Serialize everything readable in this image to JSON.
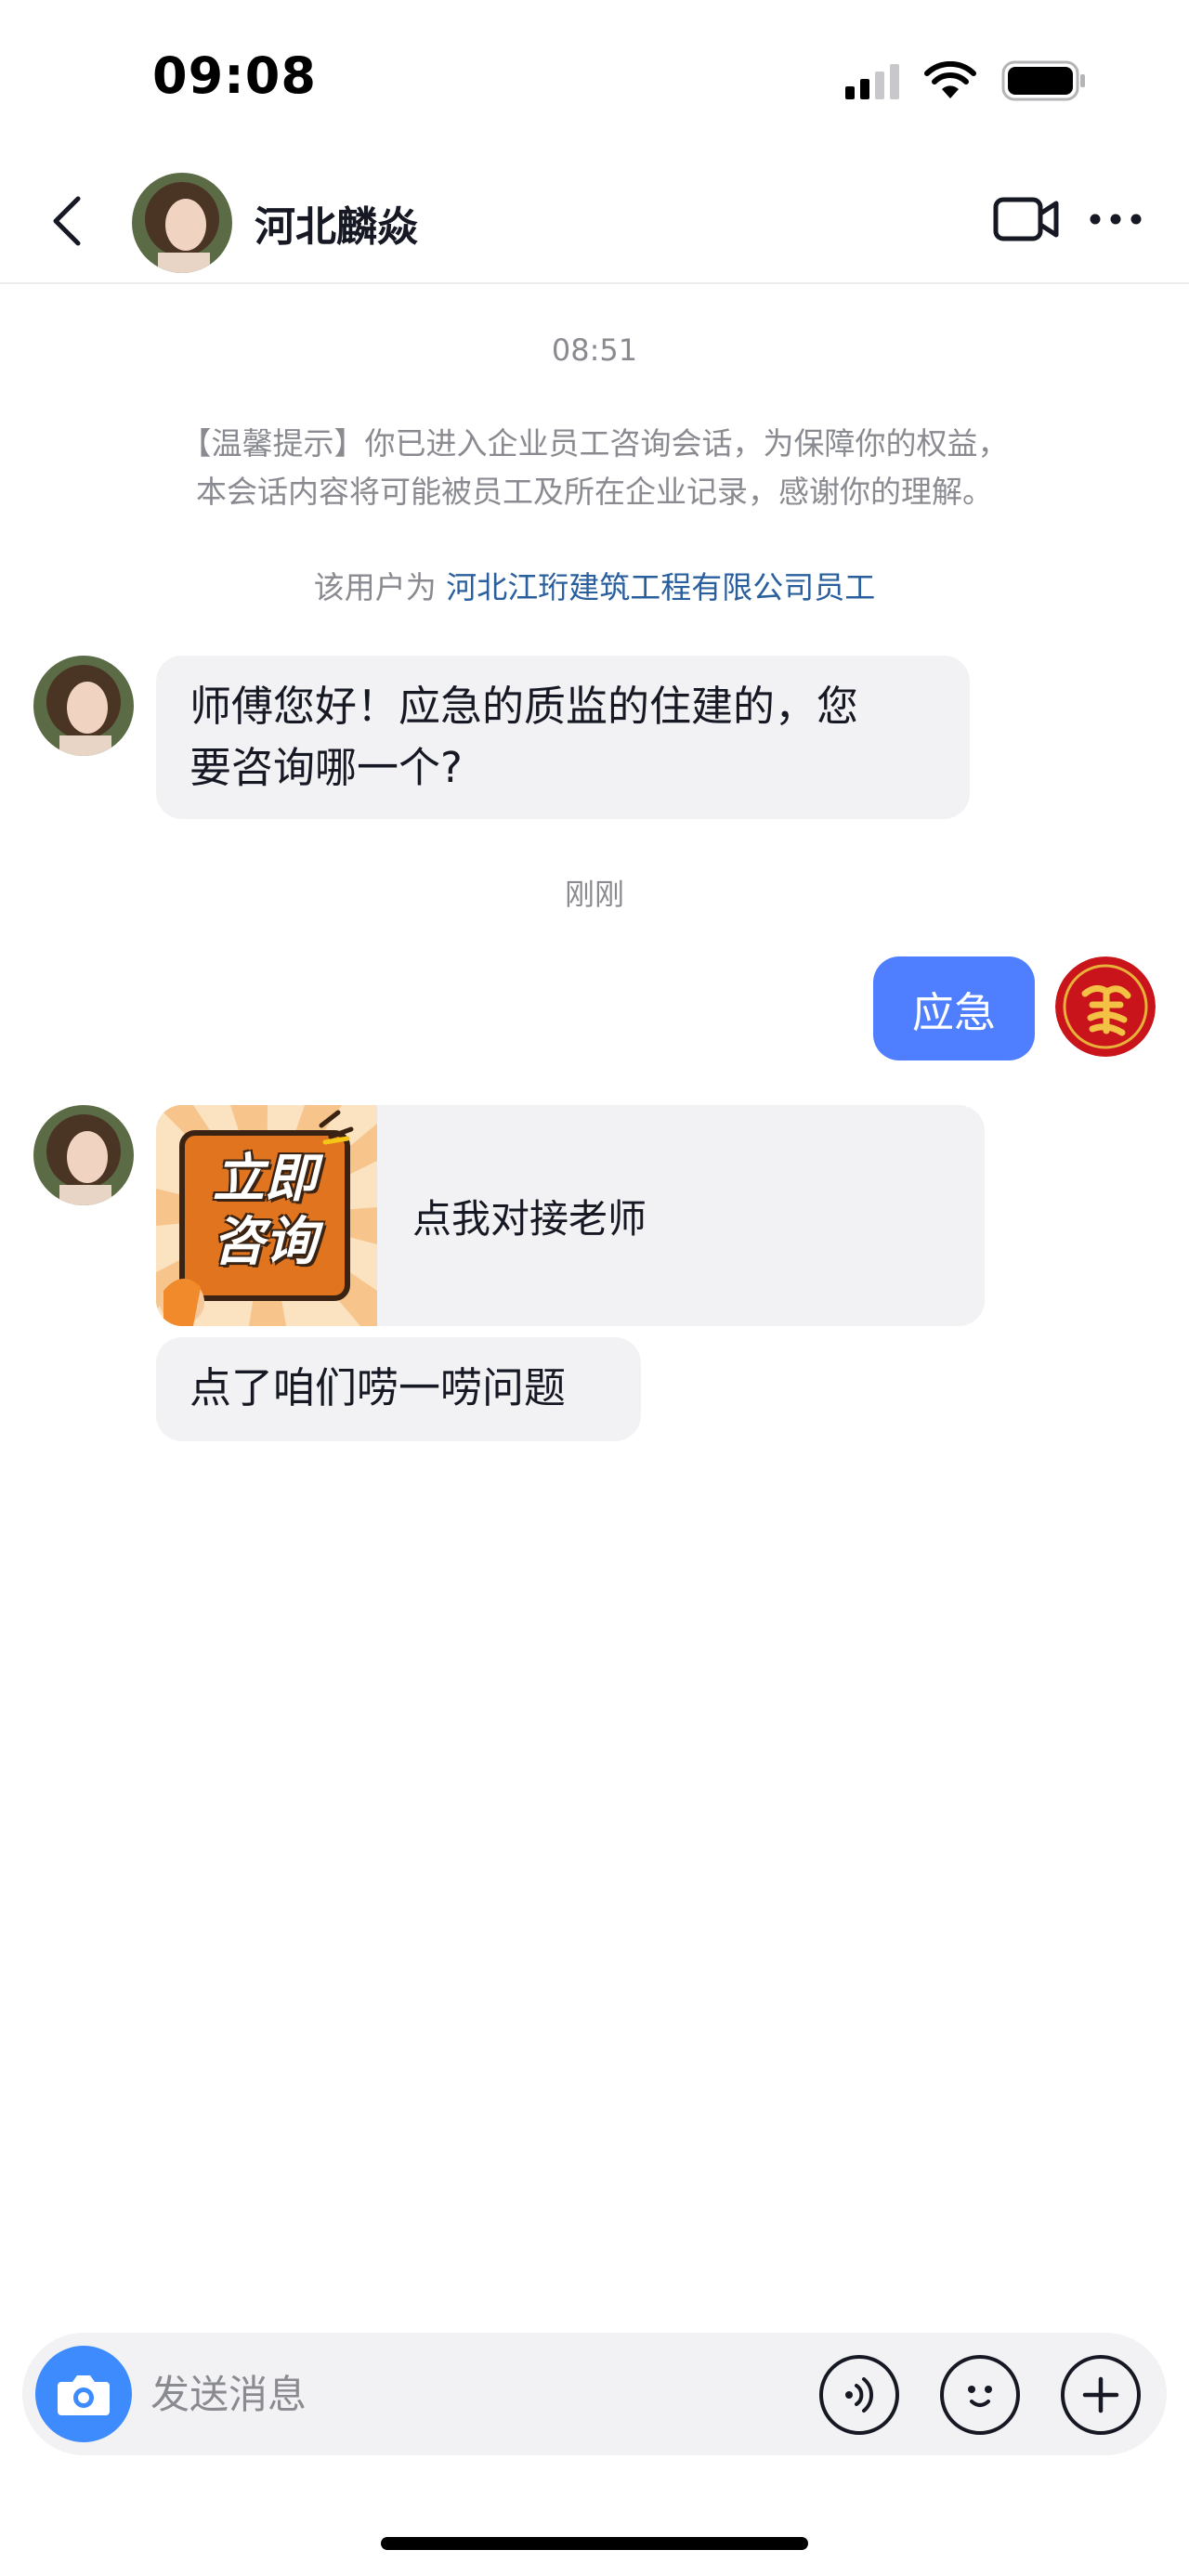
{
  "status_bar": {
    "time": "09:08",
    "icons": [
      "cellular-signal-icon",
      "wifi-icon",
      "battery-icon"
    ]
  },
  "nav": {
    "title": "河北麟焱",
    "icons": [
      "back-arrow-icon",
      "video-call-icon",
      "more-icon"
    ]
  },
  "chat": {
    "timestamp_1": "08:51",
    "notice_line_1": "【温馨提示】你已进入企业员工咨询会话，为保障你的权益，",
    "notice_line_2": "本会话内容将可能被员工及所在企业记录，感谢你的理解。",
    "identity_prefix": "该用户为",
    "identity_company": "河北江珩建筑工程有限公司员工",
    "message_1_line_1": "师傅您好！应急的质监的住建的，您",
    "message_1_line_2": "要咨询哪一个?",
    "timestamp_2": "刚刚",
    "reply_1": "应急",
    "card_badge_line_1": "立即",
    "card_badge_line_2": "咨询",
    "card_label": "点我对接老师",
    "message_2": "点了咱们唠一唠问题"
  },
  "input_bar": {
    "placeholder": "发送消息",
    "icons": [
      "camera-icon",
      "voice-icon",
      "emoji-icon",
      "plus-icon"
    ]
  },
  "colors": {
    "outgoing_bubble": "#4f7ffe",
    "incoming_bubble": "#f2f2f4",
    "link": "#2a5f9e",
    "camera_button": "#3d8bfd"
  }
}
